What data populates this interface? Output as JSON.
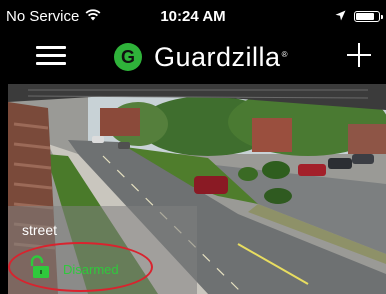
{
  "status_bar": {
    "carrier": "No Service",
    "time": "10:24 AM",
    "battery_level": 0.85,
    "icons": [
      "wifi-icon",
      "location-arrow-icon",
      "battery-icon"
    ]
  },
  "nav": {
    "brand_name": "Guardzilla",
    "brand_mark": "®",
    "logo_letter": "G",
    "icons": [
      "hamburger-menu-icon",
      "plus-icon"
    ]
  },
  "camera": {
    "name": "street",
    "status": "Disarmed",
    "status_icon": "unlocked-padlock-icon",
    "colors": {
      "status": "#2fc93c",
      "highlight": "#d9232e",
      "brand": "#2fb33a"
    }
  }
}
